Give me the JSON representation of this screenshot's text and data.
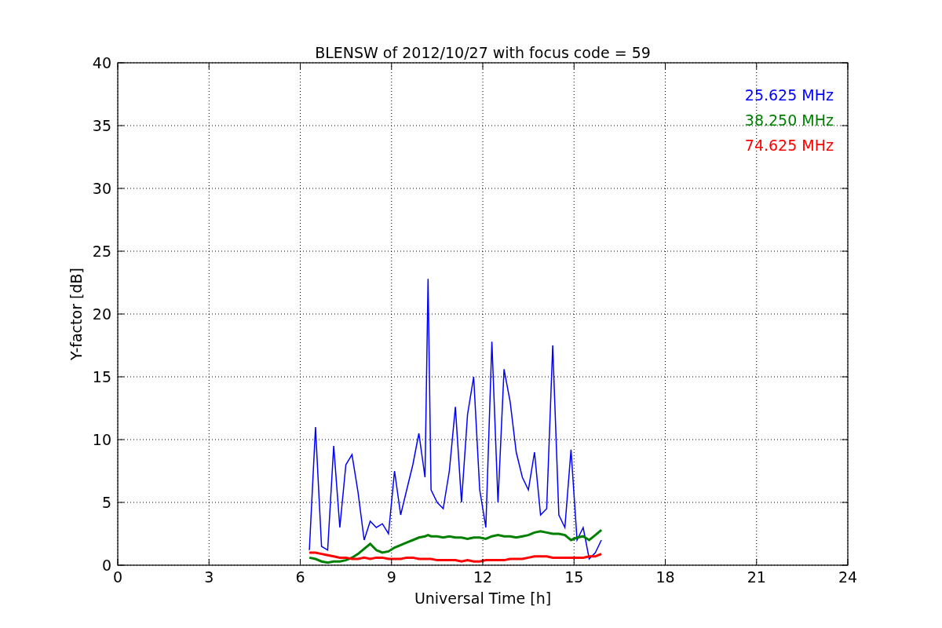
{
  "figure": {
    "chart_data": {
      "type": "line",
      "grid": true,
      "title": "BLENSW of 2012/10/27 with focus code = 59",
      "xlabel": "Universal Time [h]",
      "ylabel": "Y-factor [dB]",
      "xlim": [
        0,
        24
      ],
      "ylim": [
        0,
        40
      ],
      "xticks": [
        0,
        3,
        6,
        9,
        12,
        15,
        18,
        21,
        24
      ],
      "yticks": [
        0,
        5,
        10,
        15,
        20,
        25,
        30,
        35,
        40
      ],
      "x": [
        6.3,
        6.5,
        6.7,
        6.9,
        7.1,
        7.3,
        7.5,
        7.7,
        7.9,
        8.1,
        8.3,
        8.5,
        8.7,
        8.9,
        9.1,
        9.3,
        9.5,
        9.7,
        9.9,
        10.1,
        10.2,
        10.3,
        10.5,
        10.7,
        10.9,
        11.1,
        11.3,
        11.5,
        11.7,
        11.9,
        12.1,
        12.3,
        12.5,
        12.7,
        12.9,
        13.1,
        13.3,
        13.5,
        13.7,
        13.9,
        14.1,
        14.3,
        14.5,
        14.7,
        14.9,
        15.1,
        15.3,
        15.5,
        15.7,
        15.9
      ],
      "series": [
        {
          "name": "25.625 MHz",
          "color": "#0000ff",
          "values": [
            1.2,
            11,
            1.5,
            1.2,
            9.5,
            3,
            8,
            8.8,
            5.8,
            2,
            3.5,
            3,
            3.3,
            2.5,
            7.5,
            4,
            6,
            8,
            10.5,
            7,
            22.8,
            6,
            5,
            4.5,
            7.5,
            12.6,
            5,
            12,
            15,
            6,
            3,
            17.8,
            5,
            15.6,
            13,
            9,
            7,
            6,
            9,
            4,
            4.5,
            17.5,
            4,
            3,
            9.2,
            2,
            3,
            0.5,
            1,
            2
          ]
        },
        {
          "name": "38.250 MHz",
          "color": "#008000",
          "values": [
            0.6,
            0.5,
            0.3,
            0.2,
            0.3,
            0.3,
            0.4,
            0.6,
            0.9,
            1.3,
            1.7,
            1.2,
            1,
            1.1,
            1.4,
            1.6,
            1.8,
            2,
            2.2,
            2.3,
            2.4,
            2.3,
            2.3,
            2.2,
            2.3,
            2.2,
            2.2,
            2.1,
            2.2,
            2.2,
            2.1,
            2.3,
            2.4,
            2.3,
            2.3,
            2.2,
            2.3,
            2.4,
            2.6,
            2.7,
            2.6,
            2.5,
            2.5,
            2.4,
            2,
            2.2,
            2.3,
            2,
            2.4,
            2.8
          ]
        },
        {
          "name": "74.625 MHz",
          "color": "#ff0000",
          "values": [
            1,
            1,
            0.9,
            0.8,
            0.7,
            0.6,
            0.6,
            0.5,
            0.5,
            0.6,
            0.5,
            0.6,
            0.6,
            0.5,
            0.5,
            0.5,
            0.6,
            0.6,
            0.5,
            0.5,
            0.5,
            0.5,
            0.4,
            0.4,
            0.4,
            0.4,
            0.3,
            0.4,
            0.3,
            0.3,
            0.4,
            0.4,
            0.4,
            0.4,
            0.5,
            0.5,
            0.5,
            0.6,
            0.7,
            0.7,
            0.7,
            0.6,
            0.6,
            0.6,
            0.6,
            0.6,
            0.6,
            0.7,
            0.7,
            0.9
          ]
        }
      ]
    }
  }
}
